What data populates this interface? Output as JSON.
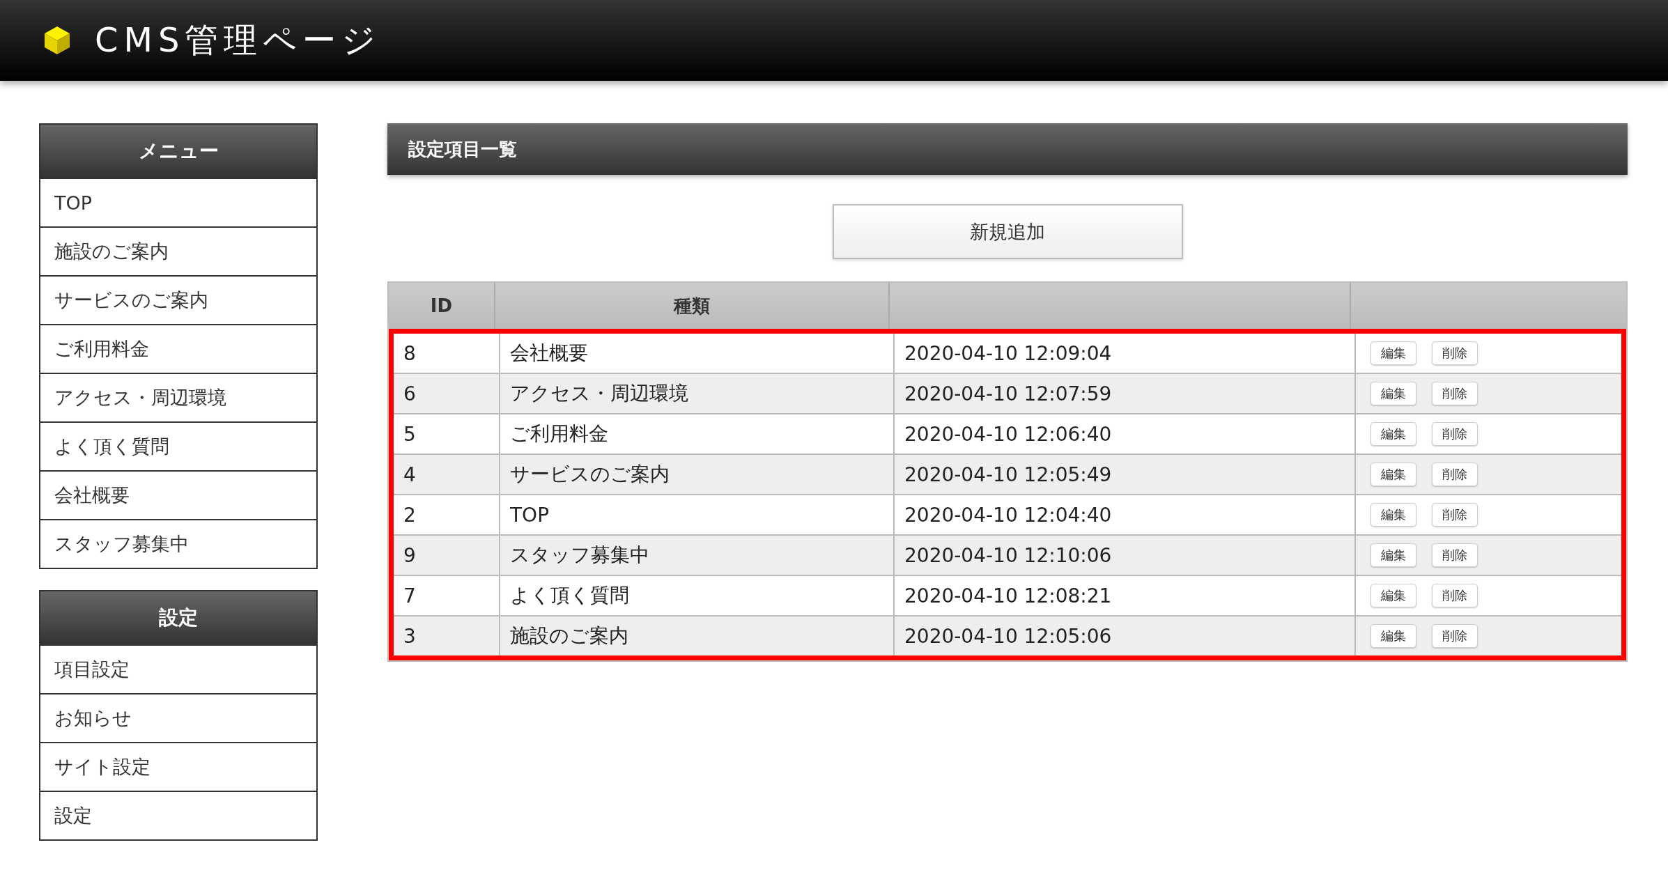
{
  "header": {
    "title": "CMS管理ページ"
  },
  "sidebar": [
    {
      "heading": "メニュー",
      "items": [
        "TOP",
        "施設のご案内",
        "サービスのご案内",
        "ご利用料金",
        "アクセス・周辺環境",
        "よく頂く質問",
        "会社概要",
        "スタッフ募集中"
      ]
    },
    {
      "heading": "設定",
      "items": [
        "項目設定",
        "お知らせ",
        "サイト設定",
        "設定"
      ]
    }
  ],
  "main": {
    "title": "設定項目一覧",
    "add_button": "新規追加",
    "table": {
      "columns": [
        "ID",
        "種類"
      ],
      "highlighted": true,
      "rows": [
        {
          "id": "8",
          "type": "会社概要",
          "date": "2020-04-10 12:09:04",
          "actions": [
            "編集",
            "削除"
          ]
        },
        {
          "id": "6",
          "type": "アクセス・周辺環境",
          "date": "2020-04-10 12:07:59",
          "actions": [
            "編集",
            "削除"
          ]
        },
        {
          "id": "5",
          "type": "ご利用料金",
          "date": "2020-04-10 12:06:40",
          "actions": [
            "編集",
            "削除"
          ]
        },
        {
          "id": "4",
          "type": "サービスのご案内",
          "date": "2020-04-10 12:05:49",
          "actions": [
            "編集",
            "削除"
          ]
        },
        {
          "id": "2",
          "type": "TOP",
          "date": "2020-04-10 12:04:40",
          "actions": [
            "編集",
            "削除"
          ]
        },
        {
          "id": "9",
          "type": "スタッフ募集中",
          "date": "2020-04-10 12:10:06",
          "actions": [
            "編集",
            "削除"
          ]
        },
        {
          "id": "7",
          "type": "よく頂く質問",
          "date": "2020-04-10 12:08:21",
          "actions": [
            "編集",
            "削除"
          ]
        },
        {
          "id": "3",
          "type": "施設のご案内",
          "date": "2020-04-10 12:05:06",
          "actions": [
            "編集",
            "削除"
          ]
        }
      ]
    }
  }
}
